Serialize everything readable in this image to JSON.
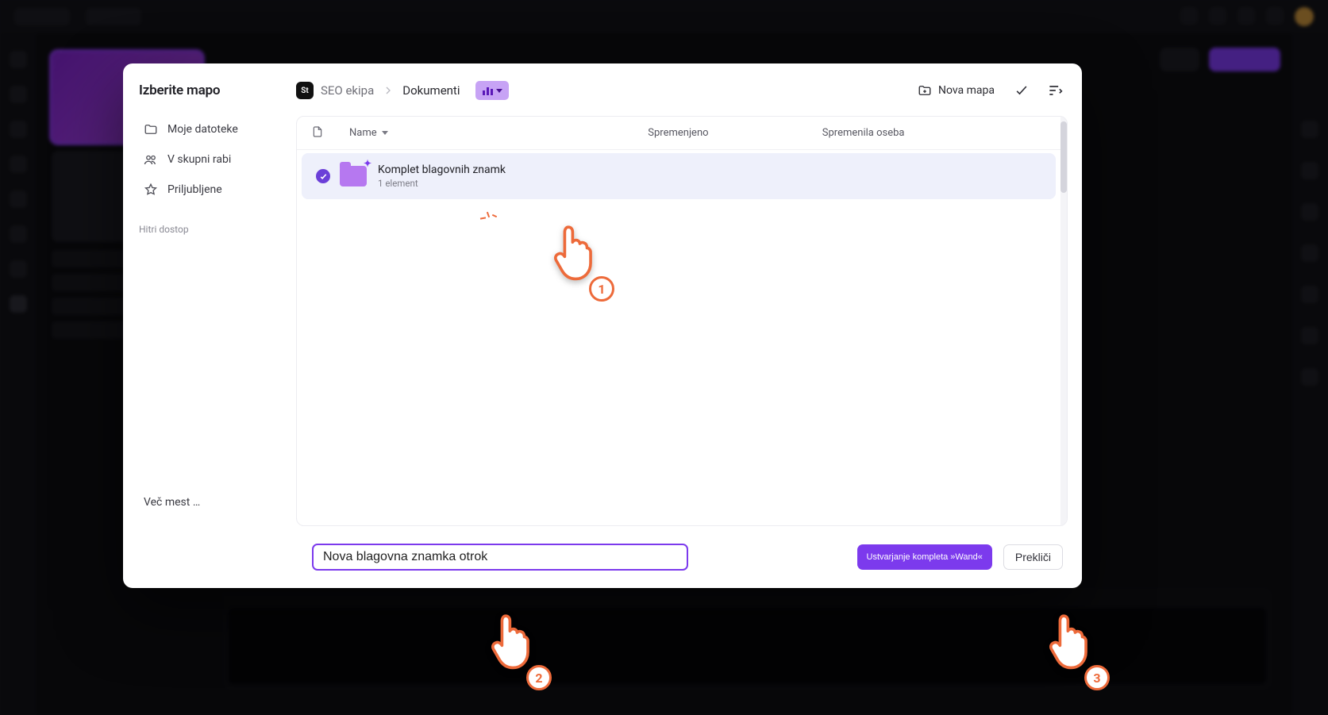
{
  "modal": {
    "title": "Izberite mapo",
    "sidebar": {
      "items": [
        {
          "icon": "folder",
          "label": "Moje datoteke"
        },
        {
          "icon": "people",
          "label": "V skupni rabi"
        },
        {
          "icon": "star",
          "label": "Priljubljene"
        }
      ],
      "quick_access_label": "Hitri dostop",
      "more_places_label": "Več mest …"
    },
    "breadcrumb": {
      "team_badge": "St",
      "team": "SEO ekipa",
      "current": "Dokumenti"
    },
    "toolbar": {
      "new_folder_label": "Nova mapa"
    },
    "columns": {
      "name": "Name",
      "modified": "Spremenjeno",
      "modified_by": "Spremenila oseba"
    },
    "rows": [
      {
        "name": "Komplet blagovnih znamk",
        "meta": "1 element",
        "selected": true
      }
    ],
    "footer": {
      "input_value": "Nova blagovna znamka otrok",
      "create_label": "Ustvarjanje kompleta »Wand«",
      "cancel_label": "Prekliči"
    }
  },
  "annotations": {
    "pointer1": "1",
    "pointer2": "2",
    "pointer3": "3"
  }
}
